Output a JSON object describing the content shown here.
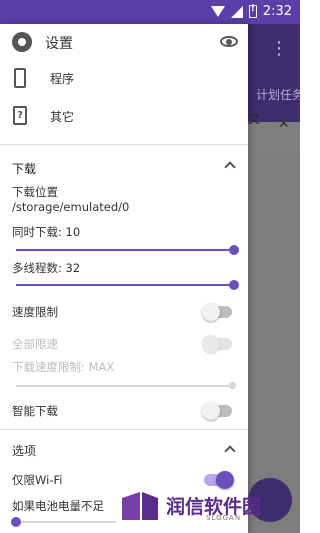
{
  "status_bar": {
    "time": "2:32"
  },
  "drawer": {
    "header_title": "设置",
    "nav": [
      {
        "label": "程序",
        "icon": "phone-icon"
      },
      {
        "label": "其它",
        "icon": "help-icon"
      }
    ]
  },
  "download_section": {
    "title": "下载",
    "location_label": "下载位置",
    "location_path": "/storage/emulated/0",
    "concurrent_label": "同时下载:  10",
    "concurrent_value": 10,
    "threads_label": "多线程数:  32",
    "threads_value": 32,
    "speed_limit_label": "速度限制",
    "speed_limit_on": false,
    "global_limit_label": "全部限速",
    "download_speed_label": "下载速度限制: MAX",
    "smart_download_label": "智能下载",
    "smart_download_on": false
  },
  "options_section": {
    "title": "选项",
    "wifi_only_label": "仅限Wi-Fi",
    "wifi_only_on": true,
    "battery_label": "如果电池电量不足"
  },
  "background": {
    "tab_text": "计划任务",
    "filter_text": "文"
  },
  "watermark": {
    "text": "润信软件园",
    "slogan": "SLOGAN"
  },
  "colors": {
    "accent": "#6b4fbb",
    "status_bar": "#5a3fa8"
  }
}
